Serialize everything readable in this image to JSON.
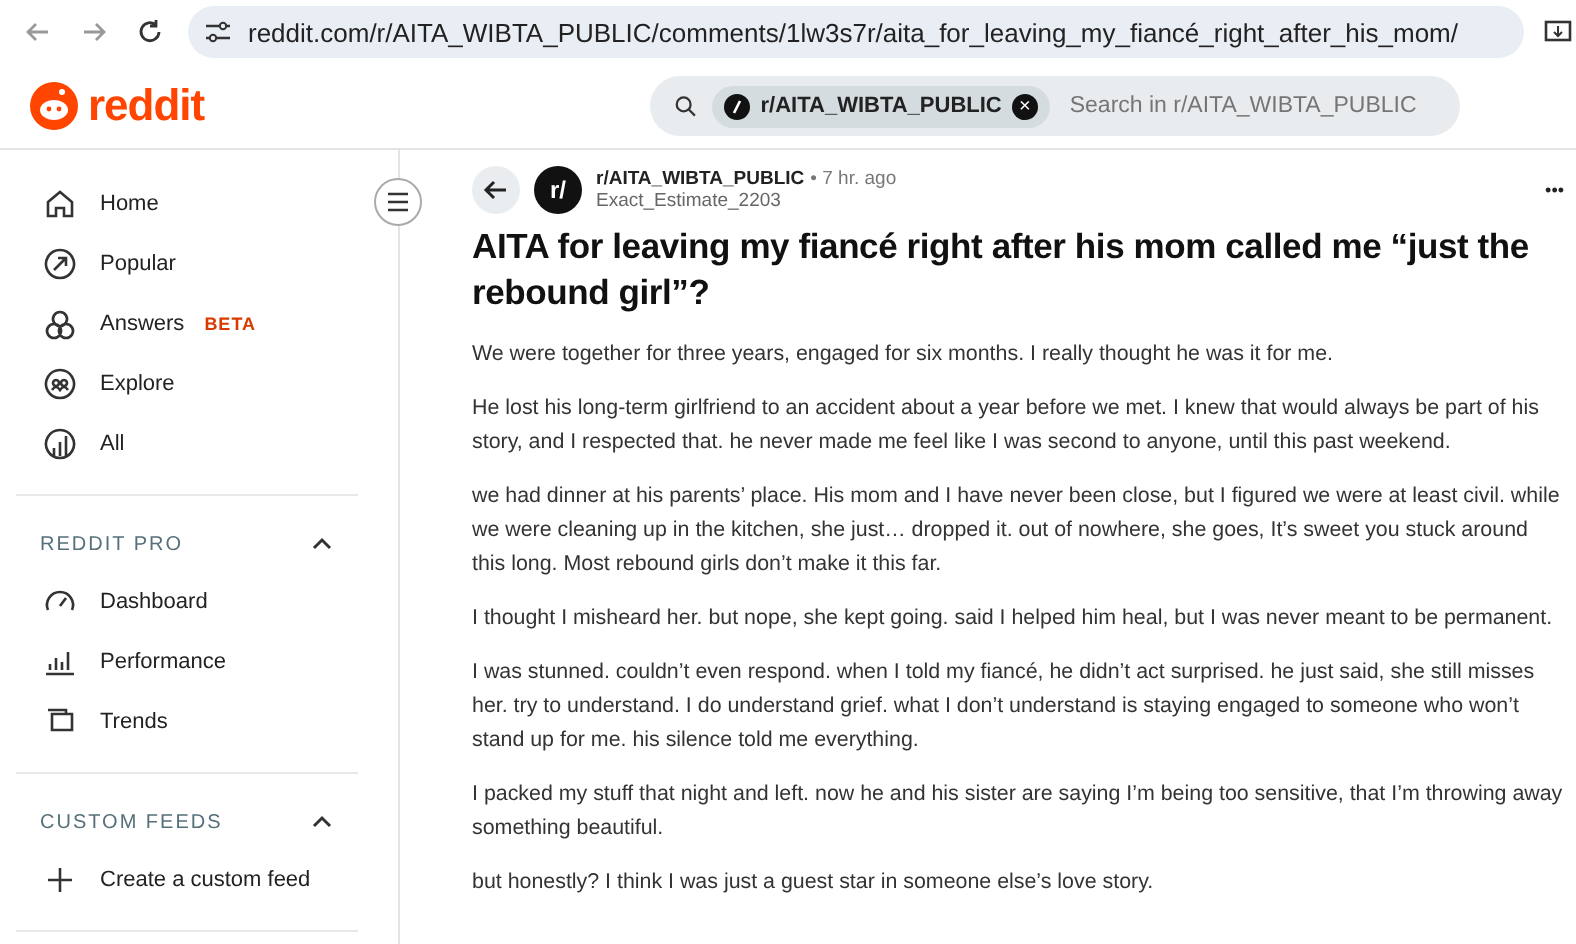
{
  "browser": {
    "url": "reddit.com/r/AITA_WIBTA_PUBLIC/comments/1lw3s7r/aita_for_leaving_my_fiancé_right_after_his_mom/"
  },
  "header": {
    "logo_text": "reddit",
    "search_chip": "r/AITA_WIBTA_PUBLIC",
    "chip_close": "×",
    "search_placeholder": "Search in r/AITA_WIBTA_PUBLIC"
  },
  "sidebar": {
    "items": [
      {
        "label": "Home"
      },
      {
        "label": "Popular"
      },
      {
        "label": "Answers",
        "badge": "BETA"
      },
      {
        "label": "Explore"
      },
      {
        "label": "All"
      }
    ],
    "sections": [
      {
        "title": "REDDIT PRO",
        "expanded": true,
        "items": [
          {
            "label": "Dashboard"
          },
          {
            "label": "Performance"
          },
          {
            "label": "Trends"
          }
        ]
      },
      {
        "title": "CUSTOM FEEDS",
        "expanded": true,
        "items": [
          {
            "label": "Create a custom feed"
          }
        ]
      }
    ]
  },
  "post": {
    "avatar_text": "r/",
    "subreddit": "r/AITA_WIBTA_PUBLIC",
    "time": "• 7 hr. ago",
    "author": "Exact_Estimate_2203",
    "more": "•••",
    "title": "AITA for leaving my fiancé right after his mom called me “just the rebound girl”?",
    "paragraphs": [
      "We were together for three years, engaged for six months. I really thought he was it for me.",
      "He lost his long-term girlfriend to an accident about a year before we met. I knew that would always be part of his story, and I respected that. he never made me feel like I was second to anyone, until this past weekend.",
      "we had dinner at his parents’ place. His mom and I have never been close, but I figured we were at least civil. while we were cleaning up in the kitchen, she just… dropped it. out of nowhere, she goes, It’s sweet you stuck around this long. Most rebound girls don’t make it this far.",
      "I thought I misheard her. but nope, she kept going. said I helped him heal, but I was never meant to be permanent.",
      "I was stunned. couldn’t even respond. when I told my fiancé, he didn’t act surprised. he just said, she still misses her. try to understand. I do understand grief. what I don’t understand is staying engaged to someone who won’t stand up for me. his silence told me everything.",
      "I packed my stuff that night and left. now he and his sister are saying I’m being too sensitive, that I’m throwing away something beautiful.",
      "but honestly? I think I was just a guest star in someone else’s love story."
    ]
  }
}
